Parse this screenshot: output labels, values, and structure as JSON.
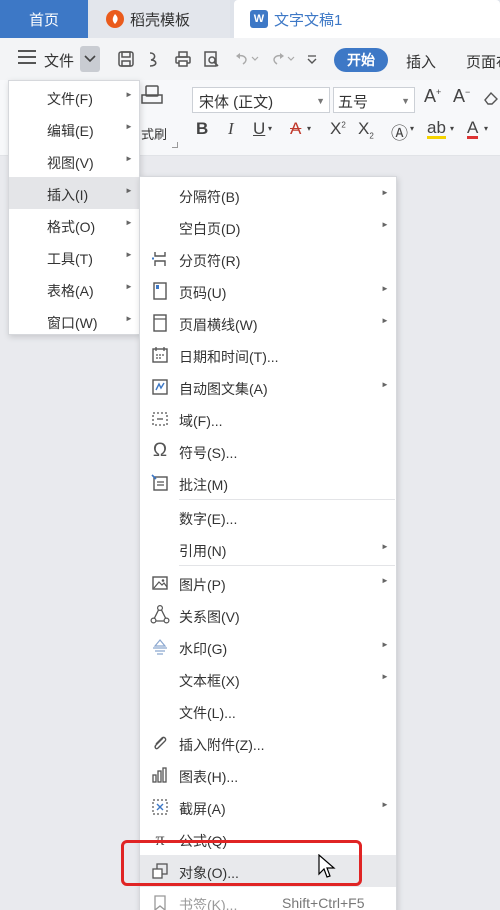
{
  "tabs": {
    "home": "首页",
    "template": "稻壳模板",
    "document": "文字文稿1"
  },
  "toolbar": {
    "file_label": "文件",
    "start": "开始",
    "insert": "插入",
    "layout": "页面布"
  },
  "ribbon": {
    "font_name": "宋体 (正文)",
    "font_size": "五号",
    "format_brush": "式刷"
  },
  "main_menu": [
    {
      "label": "文件(F)"
    },
    {
      "label": "编辑(E)"
    },
    {
      "label": "视图(V)"
    },
    {
      "label": "插入(I)"
    },
    {
      "label": "格式(O)"
    },
    {
      "label": "工具(T)"
    },
    {
      "label": "表格(A)"
    },
    {
      "label": "窗口(W)"
    }
  ],
  "insert_menu": [
    {
      "label": "分隔符(B)",
      "icon": "none"
    },
    {
      "label": "空白页(D)",
      "icon": "none"
    },
    {
      "label": "分页符(R)",
      "icon": "page-break-icon"
    },
    {
      "label": "页码(U)",
      "icon": "page-number-icon"
    },
    {
      "label": "页眉横线(W)",
      "icon": "header-line-icon"
    },
    {
      "label": "日期和时间(T)...",
      "icon": "calendar-icon"
    },
    {
      "label": "自动图文集(A)",
      "icon": "autotext-icon"
    },
    {
      "label": "域(F)...",
      "icon": "field-icon"
    },
    {
      "label": "符号(S)...",
      "icon": "omega-icon"
    },
    {
      "label": "批注(M)",
      "icon": "comment-icon"
    },
    {
      "label": "数字(E)...",
      "icon": "none"
    },
    {
      "label": "引用(N)",
      "icon": "none"
    },
    {
      "label": "图片(P)",
      "icon": "picture-icon"
    },
    {
      "label": "关系图(V)",
      "icon": "relation-icon"
    },
    {
      "label": "水印(G)",
      "icon": "watermark-icon"
    },
    {
      "label": "文本框(X)",
      "icon": "none"
    },
    {
      "label": "文件(L)...",
      "icon": "none"
    },
    {
      "label": "插入附件(Z)...",
      "icon": "paperclip-icon"
    },
    {
      "label": "图表(H)...",
      "icon": "chart-icon"
    },
    {
      "label": "截屏(A)",
      "icon": "screenshot-icon"
    },
    {
      "label": "公式(Q)",
      "icon": "formula-icon"
    },
    {
      "label": "对象(O)...",
      "icon": "object-icon"
    },
    {
      "label": "书签(K)...",
      "icon": "bookmark-icon",
      "shortcut": "Shift+Ctrl+F5"
    }
  ],
  "colors": {
    "accent": "#3d78c6",
    "highlight_border": "#e02424"
  }
}
